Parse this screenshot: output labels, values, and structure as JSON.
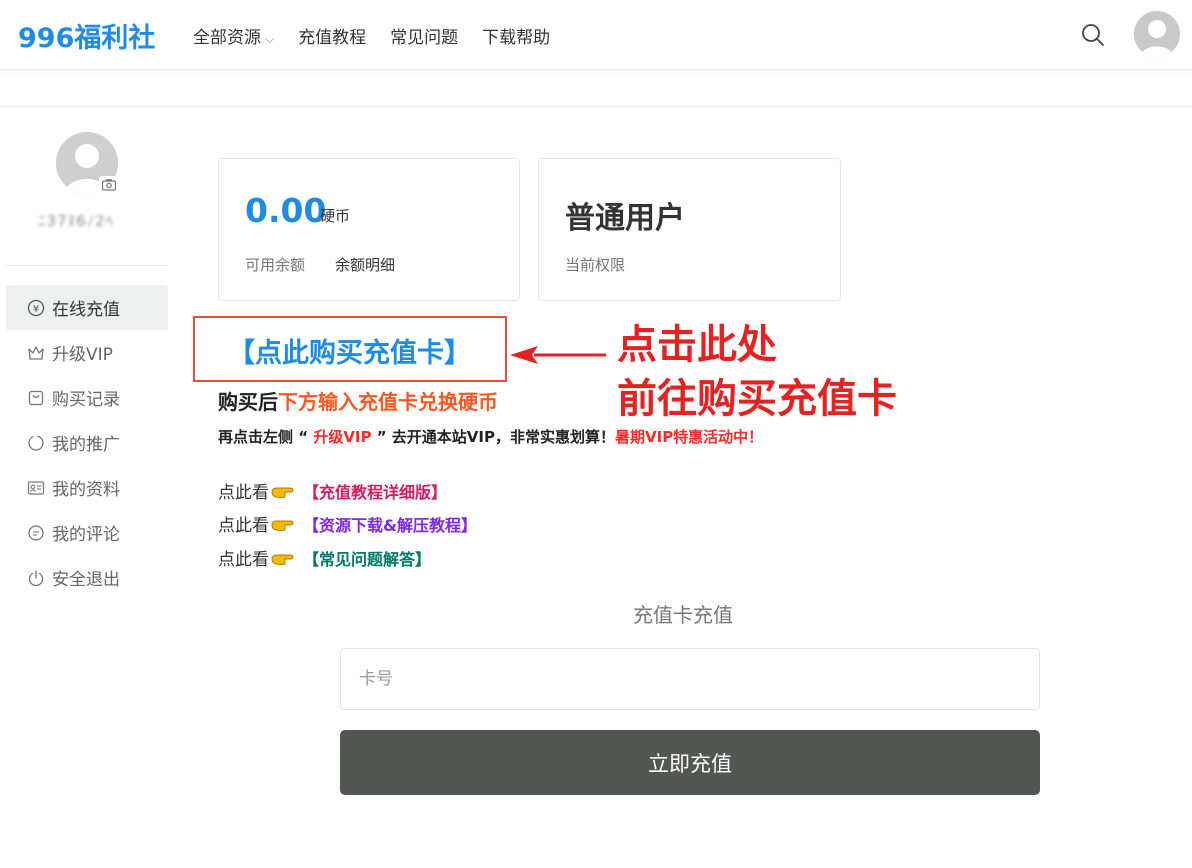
{
  "header": {
    "logo": "996福利社",
    "nav": [
      {
        "label": "全部资源",
        "caret": "⌵"
      },
      {
        "label": "充值教程"
      },
      {
        "label": "常见问题"
      },
      {
        "label": "下载帮助"
      }
    ]
  },
  "sidebar": {
    "username": "ﾆ37ﾇ6ﾉ2ﾍ",
    "menu": [
      {
        "label": "在线充值",
        "icon": "yen-icon",
        "active": true
      },
      {
        "label": "升级VIP",
        "icon": "crown-icon"
      },
      {
        "label": "购买记录",
        "icon": "bag-icon"
      },
      {
        "label": "我的推广",
        "icon": "share-icon"
      },
      {
        "label": "我的资料",
        "icon": "id-card-icon"
      },
      {
        "label": "我的评论",
        "icon": "comment-icon"
      },
      {
        "label": "安全退出",
        "icon": "power-icon"
      }
    ]
  },
  "balance_card": {
    "amount": "0.00",
    "unit": "硬币",
    "label": "可用余额",
    "detail_link": "余额明细"
  },
  "role_card": {
    "role": "普通用户",
    "label": "当前权限"
  },
  "promo": {
    "buy_link": "【点此购买充值卡】",
    "callout_line1": "点击此处",
    "callout_line2": "前往购买充值卡",
    "after_buy_prefix": "购买后",
    "after_buy_highlight": "下方输入充值卡兑换硬币",
    "vip_line_a": "再点击左侧 “ ",
    "vip_line_b": "升级VIP",
    "vip_line_c": " ” 去开通本站VIP，非常实惠划算！",
    "vip_line_d": "暑期VIP特惠活动中！",
    "look_prefix": "点此看",
    "links": [
      {
        "label": "【充值教程详细版】",
        "color": "#d81b60"
      },
      {
        "label": "【资源下载&解压教程】",
        "color": "#7c2ae8"
      },
      {
        "label": "【常见问题解答】",
        "color": "#00796b"
      }
    ]
  },
  "recharge": {
    "title": "充值卡充值",
    "placeholder": "卡号",
    "submit": "立即充值"
  },
  "colors": {
    "brand": "#1e8ce6",
    "callout": "#e52222",
    "button": "#525753"
  }
}
